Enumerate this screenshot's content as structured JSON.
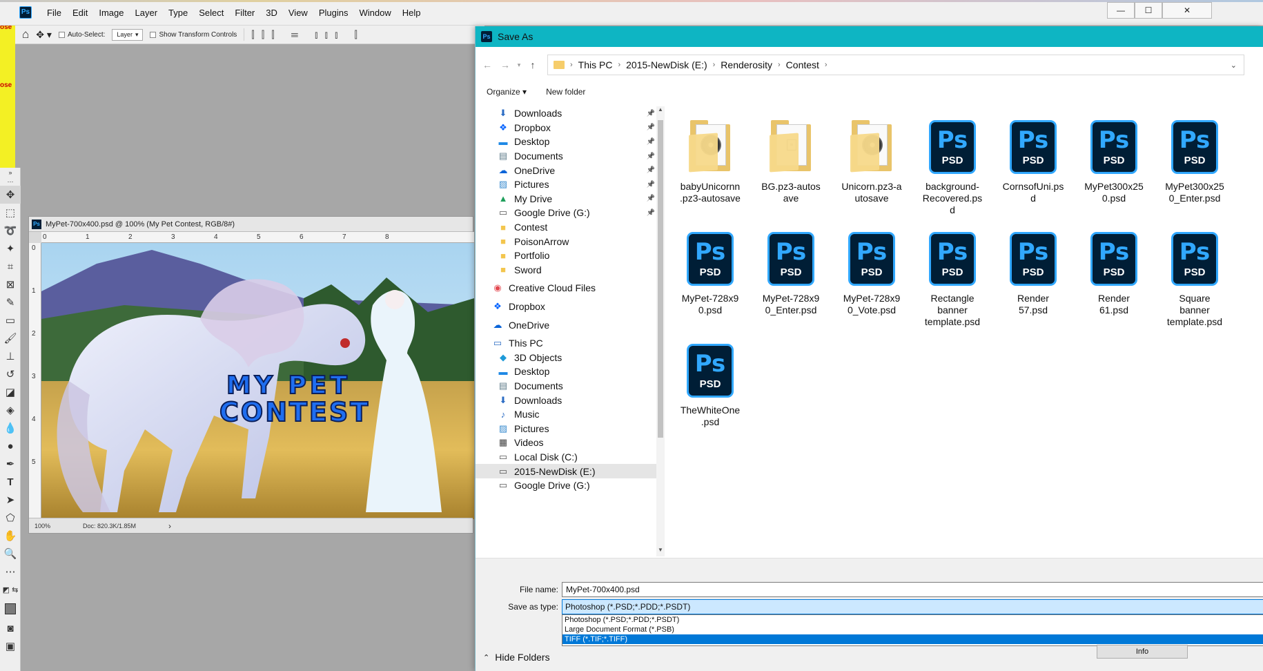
{
  "app": {
    "menu": [
      "File",
      "Edit",
      "Image",
      "Layer",
      "Type",
      "Select",
      "Filter",
      "3D",
      "View",
      "Plugins",
      "Window",
      "Help"
    ],
    "logo": "Ps",
    "window_controls": {
      "minimize": "—",
      "maximize": "☐",
      "close": "✕"
    }
  },
  "options_bar": {
    "auto_select_label": "Auto-Select:",
    "auto_select_target": "Layer",
    "show_transform_label": "Show Transform Controls"
  },
  "document": {
    "title": "MyPet-700x400.psd @ 100% (My Pet Contest, RGB/8#)",
    "ruler_h": [
      "0",
      "1",
      "2",
      "3",
      "4",
      "5",
      "6",
      "7",
      "8"
    ],
    "ruler_v": [
      "0",
      "1",
      "2",
      "3",
      "4",
      "5"
    ],
    "canvas_text_line1": "MY PET",
    "canvas_text_line2": "CONTEST",
    "zoom": "100%",
    "doc_info": "Doc: 820.3K/1.85M",
    "status_arrow": "›"
  },
  "dialog": {
    "title": "Save As",
    "title_icon": "Ps",
    "breadcrumbs": [
      "This PC",
      "2015-NewDisk (E:)",
      "Renderosity",
      "Contest"
    ],
    "organize_label": "Organize ▾",
    "new_folder_label": "New folder",
    "nav_items": [
      {
        "label": "Downloads",
        "icon": "download-icon",
        "pinned": true,
        "level": 1
      },
      {
        "label": "Dropbox",
        "icon": "dropbox-icon",
        "pinned": true,
        "level": 1
      },
      {
        "label": "Desktop",
        "icon": "desktop-icon",
        "pinned": true,
        "level": 1
      },
      {
        "label": "Documents",
        "icon": "documents-icon",
        "pinned": true,
        "level": 1
      },
      {
        "label": "OneDrive",
        "icon": "cloud-icon",
        "pinned": true,
        "level": 1
      },
      {
        "label": "Pictures",
        "icon": "pictures-icon",
        "pinned": true,
        "level": 1
      },
      {
        "label": "My Drive",
        "icon": "drive-icon",
        "pinned": true,
        "level": 1
      },
      {
        "label": "Google Drive (G:)",
        "icon": "disk-icon",
        "pinned": true,
        "level": 1
      },
      {
        "label": "Contest",
        "icon": "folder-icon",
        "pinned": false,
        "level": 1
      },
      {
        "label": "PoisonArrow",
        "icon": "folder-icon",
        "pinned": false,
        "level": 1
      },
      {
        "label": "Portfolio",
        "icon": "folder-icon",
        "pinned": false,
        "level": 1
      },
      {
        "label": "Sword",
        "icon": "folder-icon",
        "pinned": false,
        "level": 1
      },
      {
        "label": "Creative Cloud Files",
        "icon": "creative-cloud-icon",
        "pinned": false,
        "level": 0
      },
      {
        "label": "Dropbox",
        "icon": "dropbox-icon",
        "pinned": false,
        "level": 0
      },
      {
        "label": "OneDrive",
        "icon": "cloud-icon",
        "pinned": false,
        "level": 0
      },
      {
        "label": "This PC",
        "icon": "computer-icon",
        "pinned": false,
        "level": 0
      },
      {
        "label": "3D Objects",
        "icon": "cube-icon",
        "pinned": false,
        "level": 1
      },
      {
        "label": "Desktop",
        "icon": "desktop-icon",
        "pinned": false,
        "level": 1
      },
      {
        "label": "Documents",
        "icon": "documents-icon",
        "pinned": false,
        "level": 1
      },
      {
        "label": "Downloads",
        "icon": "download-icon",
        "pinned": false,
        "level": 1
      },
      {
        "label": "Music",
        "icon": "music-icon",
        "pinned": false,
        "level": 1
      },
      {
        "label": "Pictures",
        "icon": "pictures-icon",
        "pinned": false,
        "level": 1
      },
      {
        "label": "Videos",
        "icon": "video-icon",
        "pinned": false,
        "level": 1
      },
      {
        "label": "Local Disk (C:)",
        "icon": "disk-icon",
        "pinned": false,
        "level": 1
      },
      {
        "label": "2015-NewDisk (E:)",
        "icon": "disk-icon",
        "pinned": false,
        "level": 1,
        "selected": true
      },
      {
        "label": "Google Drive (G:)",
        "icon": "disk-icon",
        "pinned": false,
        "level": 1
      }
    ],
    "files": [
      {
        "name": "babyUnicornn.pz3-autosave",
        "lines": [
          "babyUnicornn",
          ".pz3-autosave"
        ],
        "kind": "folder-disc"
      },
      {
        "name": "BG.pz3-autosave",
        "lines": [
          "BG.pz3-autos",
          "ave"
        ],
        "kind": "folder-doc"
      },
      {
        "name": "Unicorn.pz3-autosave",
        "lines": [
          "Unicorn.pz3-a",
          "utosave"
        ],
        "kind": "folder-disc"
      },
      {
        "name": "background-Recovered.psd",
        "lines": [
          "background-",
          "Recovered.ps",
          "d"
        ],
        "kind": "psd"
      },
      {
        "name": "CornsofUni.psd",
        "lines": [
          "CornsofUni.ps",
          "d"
        ],
        "kind": "psd"
      },
      {
        "name": "MyPet300x250.psd",
        "lines": [
          "MyPet300x25",
          "0.psd"
        ],
        "kind": "psd"
      },
      {
        "name": "MyPet300x250_Enter.psd",
        "lines": [
          "MyPet300x25",
          "0_Enter.psd"
        ],
        "kind": "psd"
      },
      {
        "name": "MyPet-728x90.psd",
        "lines": [
          "MyPet-728x9",
          "0.psd"
        ],
        "kind": "psd"
      },
      {
        "name": "MyPet-728x90_Enter.psd",
        "lines": [
          "MyPet-728x9",
          "0_Enter.psd"
        ],
        "kind": "psd"
      },
      {
        "name": "MyPet-728x90_Vote.psd",
        "lines": [
          "MyPet-728x9",
          "0_Vote.psd"
        ],
        "kind": "psd"
      },
      {
        "name": "Rectangle banner template.psd",
        "lines": [
          "Rectangle",
          "banner",
          "template.psd"
        ],
        "kind": "psd"
      },
      {
        "name": "Render 57.psd",
        "lines": [
          "Render",
          "57.psd"
        ],
        "kind": "psd"
      },
      {
        "name": "Render 61.psd",
        "lines": [
          "Render",
          "61.psd"
        ],
        "kind": "psd"
      },
      {
        "name": "Square banner template.psd",
        "lines": [
          "Square",
          "banner",
          "template.psd"
        ],
        "kind": "psd"
      },
      {
        "name": "TheWhiteOne.psd",
        "lines": [
          "TheWhiteOne",
          ".psd"
        ],
        "kind": "psd"
      }
    ],
    "psd_icon_text": "Ps",
    "psd_icon_tag": "PSD",
    "file_name_label": "File name:",
    "file_name_value": "MyPet-700x400.psd",
    "save_type_label": "Save as type:",
    "save_type_value": "Photoshop (*.PSD;*.PDD;*.PSDT)",
    "save_type_options": [
      {
        "label": "Photoshop (*.PSD;*.PDD;*.PSDT)",
        "highlighted": false
      },
      {
        "label": "Large Document Format (*.PSB)",
        "highlighted": false
      },
      {
        "label": "TIFF (*.TIF;*.TIFF)",
        "highlighted": true
      }
    ],
    "info_button": "Info",
    "hide_folders_label": "Hide Folders"
  },
  "colors": {
    "dialog_title_bar": "#0eb5c3",
    "ps_blue": "#31a8ff",
    "ps_dark": "#001e36",
    "selection_blue": "#0078d7",
    "left_strip_yellow": "#f3f024"
  }
}
